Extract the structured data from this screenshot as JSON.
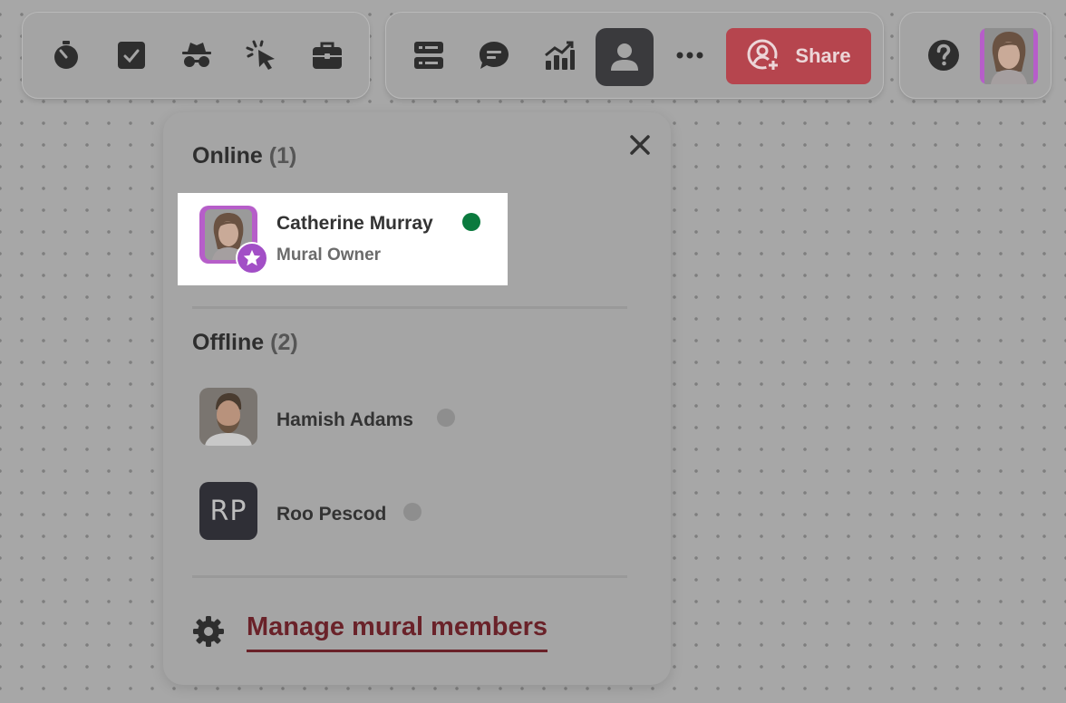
{
  "toolbar_left": {
    "icons": [
      "timer-icon",
      "checklist-icon",
      "private-mode-icon",
      "laser-pointer-icon",
      "toolkit-icon"
    ]
  },
  "toolbar_center": {
    "icons": [
      "outline-icon",
      "comments-icon",
      "activity-icon",
      "collaborators-icon",
      "more-icon"
    ],
    "share_label": "Share"
  },
  "toolbar_right": {
    "icons": [
      "help-icon"
    ]
  },
  "panel": {
    "online": {
      "label": "Online",
      "count": "(1)"
    },
    "offline": {
      "label": "Offline",
      "count": "(2)"
    },
    "members_online": [
      {
        "name": "Catherine Murray",
        "role": "Mural Owner",
        "status": "online"
      }
    ],
    "members_offline": [
      {
        "name": "Hamish Adams",
        "status": "offline"
      },
      {
        "name": "Roo Pescod",
        "initials": "RP",
        "status": "offline"
      }
    ],
    "manage_label": "Manage mural members"
  },
  "colors": {
    "share": "#b6454e",
    "online_dot": "#0b7a3e",
    "offline_dot": "#8e8e8e",
    "owner_badge": "#a24fc6",
    "manage_link": "#6a2229"
  }
}
